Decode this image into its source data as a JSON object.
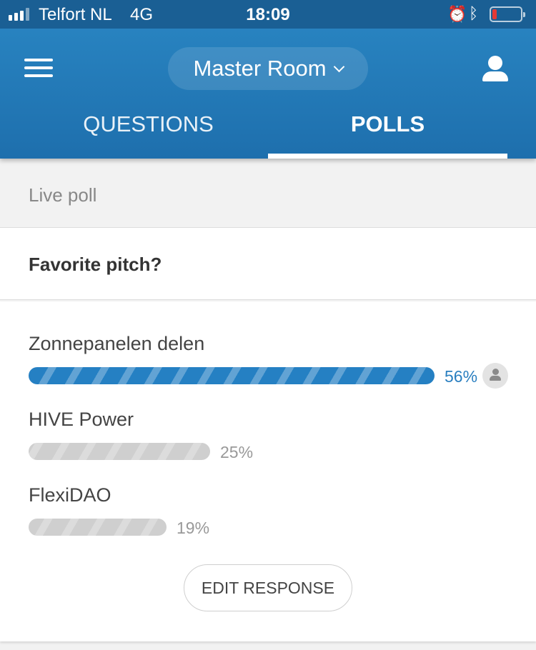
{
  "statusbar": {
    "carrier": "Telfort NL",
    "network": "4G",
    "time": "18:09",
    "battery_level": 0.15,
    "signal_bars": 3,
    "icons": [
      "alarm-icon",
      "bluetooth-icon",
      "battery-icon"
    ]
  },
  "header": {
    "room_name": "Master Room",
    "tabs": [
      {
        "label": "QUESTIONS",
        "active": false
      },
      {
        "label": "POLLS",
        "active": true
      }
    ],
    "accent_color": "#1e6fad"
  },
  "poll": {
    "section_label": "Live poll",
    "question": "Favorite pitch?",
    "options": [
      {
        "label": "Zonnepanelen delen",
        "percent": 56,
        "percent_label": "56%",
        "selected": true
      },
      {
        "label": "HIVE Power",
        "percent": 25,
        "percent_label": "25%",
        "selected": false
      },
      {
        "label": "FlexiDAO",
        "percent": 19,
        "percent_label": "19%",
        "selected": false
      }
    ],
    "edit_button": "EDIT RESPONSE",
    "selected_color": "#2580c3",
    "unselected_color": "#cfcfcf"
  }
}
